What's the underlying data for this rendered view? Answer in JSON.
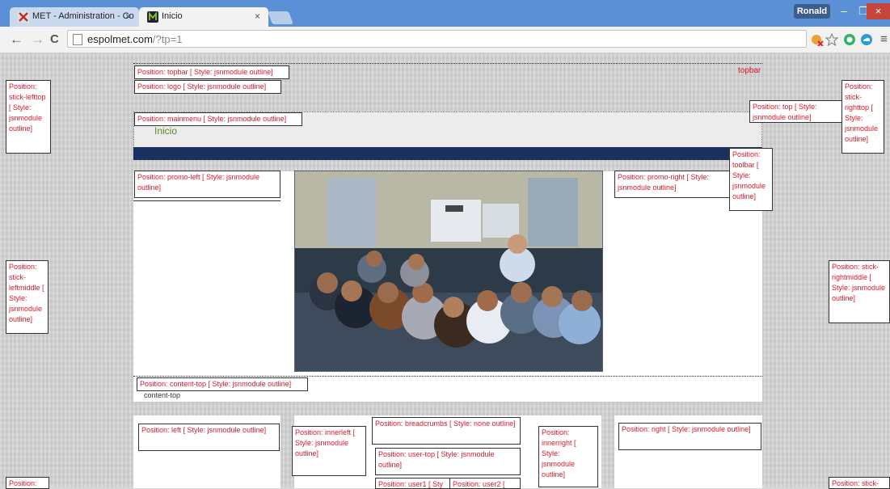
{
  "browser": {
    "tabs": [
      {
        "title": "MET - Administration - Co",
        "active": false
      },
      {
        "title": "Inicio",
        "active": true
      }
    ],
    "tab_close": "×",
    "user": "Ronald",
    "window_controls": {
      "minimize": "–",
      "maximize": "❐",
      "close": "×"
    },
    "nav": {
      "back": "←",
      "forward": "→",
      "reload": "C"
    },
    "url": {
      "domain": "espolmet.com",
      "path": "/?tp=1"
    },
    "icons": [
      "page-icon",
      "extension-blocked-icon",
      "star-icon",
      "green-circle-icon",
      "cloud-icon",
      "menu-icon"
    ],
    "menu_glyph": "≡"
  },
  "page": {
    "topbar_label": "topbar",
    "menu_item": "Inicio",
    "content_top_label": "content-top",
    "positions": {
      "topbar": "Position: topbar [ Style: jsnmodule outline]",
      "logo": "Position: logo [ Style: jsnmodule outline]",
      "mainmenu": "Position: mainmenu [ Style: jsnmodule outline]",
      "top": "Position: top [ Style: jsnmodule outline]",
      "stick_lefttop": "Position: stick-lefttop [ Style: jsnmodule outline]",
      "stick_righttop": "Position: stick-righttop [ Style: jsnmodule outline]",
      "toolbar": "Position: toolbar [ Style: jsnmodule outline]",
      "promo_left": "Position: promo-left [ Style: jsnmodule outline]",
      "promo_right": "Position: promo-right [ Style: jsnmodule outline]",
      "stick_leftmiddle": "Position: stick-leftmiddle [ Style: jsnmodule outline]",
      "stick_rightmiddle": "Position: stick-rightmiddle [ Style: jsnmodule outline]",
      "content_top": "Position: content-top [ Style: jsnmodule outline]",
      "left": "Position: left [ Style: jsnmodule outline]",
      "innerleft": "Position: innerleft [ Style: jsnmodule outline]",
      "breadcrumbs": "Position: breadcrumbs [ Style: none outline]",
      "user_top": "Position: user-top [ Style: jsnmodule outline]",
      "innerright": "Position: innerright [ Style: jsnmodule outline]",
      "right": "Position: right [ Style: jsnmodule outline]",
      "user1": "Position: user1 [ Sty",
      "user2": "Position: user2 [",
      "stick_leftbottom": "Position:",
      "stick_rightbottom": "Position: stick-"
    }
  },
  "colors": {
    "accent_label": "#d6192a",
    "menu_green": "#5d8b20",
    "navy_band": "#1c3060",
    "tab_strip": "#5b8fd6"
  }
}
